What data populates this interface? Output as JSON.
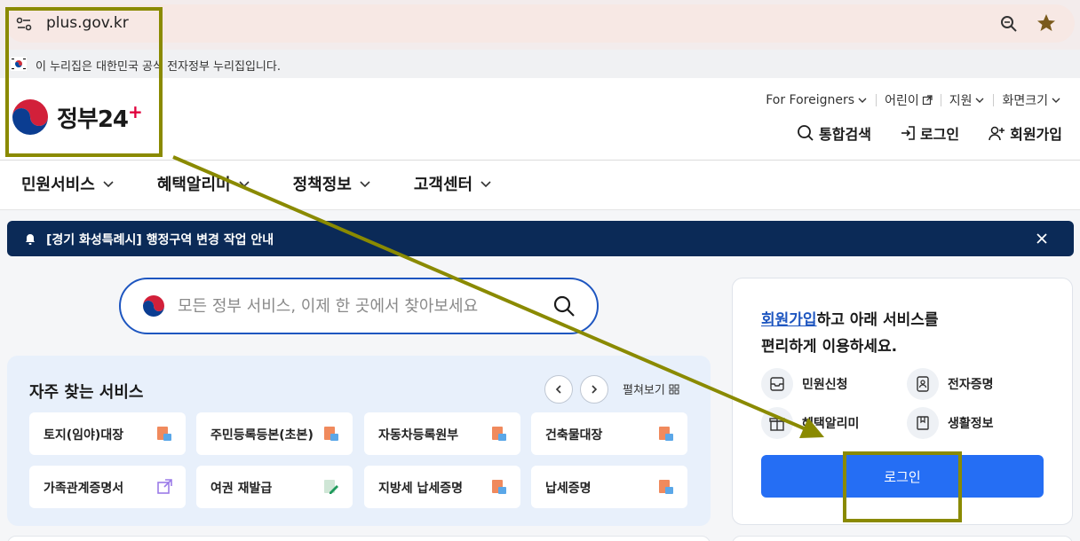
{
  "browser": {
    "url": "plus.gov.kr"
  },
  "official_banner": {
    "text": "이 누리집은 대한민국 공식 전자정부 누리집입니다."
  },
  "header": {
    "logo_text": "정부",
    "logo_number": "24",
    "logo_plus": "+",
    "util_links": [
      {
        "label": "For Foreigners"
      },
      {
        "label": "어린이"
      },
      {
        "label": "지원"
      },
      {
        "label": "화면크기"
      }
    ],
    "actions": [
      {
        "label": "통합검색",
        "icon": "search-icon"
      },
      {
        "label": "로그인",
        "icon": "login-icon"
      },
      {
        "label": "회원가입",
        "icon": "user-plus-icon"
      }
    ]
  },
  "gnb": {
    "menus": [
      {
        "label": "민원서비스"
      },
      {
        "label": "혜택알리미"
      },
      {
        "label": "정책정보"
      },
      {
        "label": "고객센터"
      }
    ]
  },
  "notice": {
    "text": "[경기 화성특례시] 행정구역 변경 작업 안내"
  },
  "search": {
    "placeholder": "모든 정부 서비스, 이제 한 곳에서 찾아보세요"
  },
  "frequent": {
    "title": "자주 찾는 서비스",
    "expand_label": "펼쳐보기",
    "services": [
      {
        "label": "토지(임야)대장",
        "icon": "pdf-doc-icon"
      },
      {
        "label": "주민등록등본(초본)",
        "icon": "pdf-doc-icon"
      },
      {
        "label": "자동차등록원부",
        "icon": "pdf-doc-icon"
      },
      {
        "label": "건축물대장",
        "icon": "pdf-doc-icon"
      },
      {
        "label": "가족관계증명서",
        "icon": "external-link-icon"
      },
      {
        "label": "여권 재발급",
        "icon": "edit-doc-icon"
      },
      {
        "label": "지방세 납세증명",
        "icon": "pdf-doc-icon"
      },
      {
        "label": "납세증명",
        "icon": "pdf-doc-icon"
      }
    ]
  },
  "login_box": {
    "signup_link": "회원가입",
    "message_rest": "하고 아래 서비스를",
    "message_line2": "편리하게 이용하세요.",
    "features": [
      {
        "label": "민원신청",
        "icon": "inbox-icon"
      },
      {
        "label": "전자증명",
        "icon": "id-card-icon"
      },
      {
        "label": "혜택알리미",
        "icon": "gift-icon"
      },
      {
        "label": "생활정보",
        "icon": "bookmark-icon"
      }
    ],
    "login_button": "로그인"
  },
  "colors": {
    "brand_blue": "#256ef4",
    "notice_navy": "#0b2a57",
    "annotation": "#8a8a00"
  }
}
